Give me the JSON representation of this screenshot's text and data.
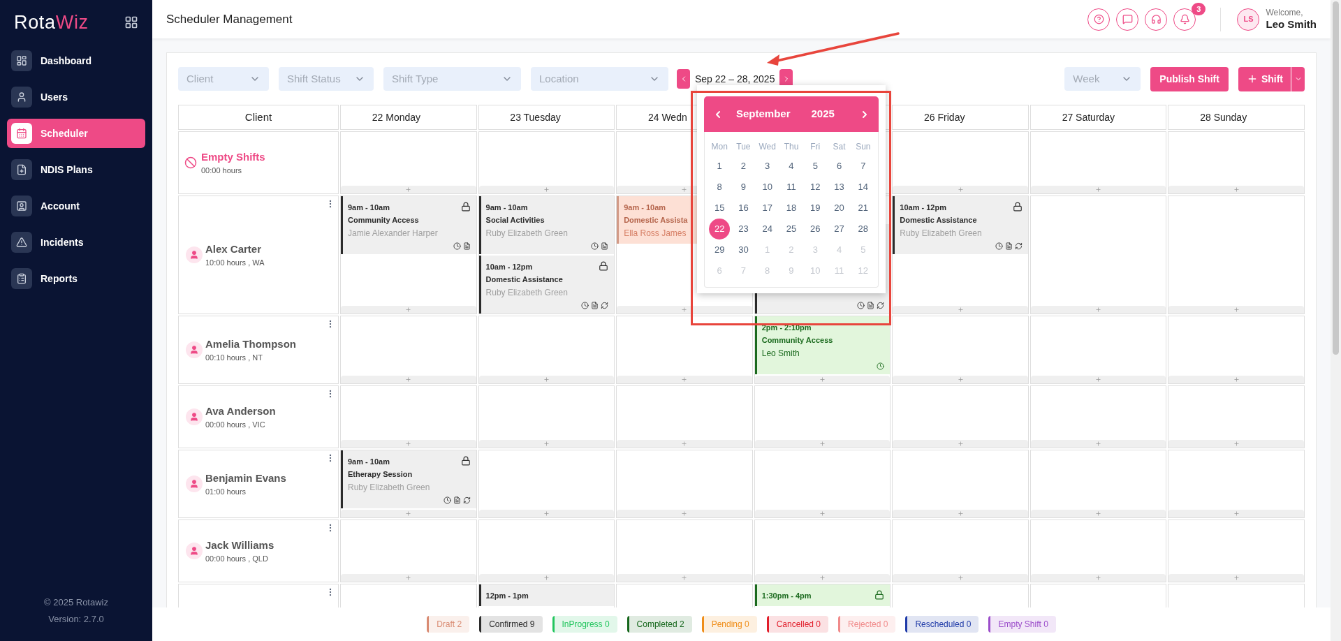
{
  "sidebar": {
    "logo": {
      "first": "Rota",
      "second": "Wiz"
    },
    "items": [
      {
        "label": "Dashboard",
        "selected": false
      },
      {
        "label": "Users",
        "selected": false
      },
      {
        "label": "Scheduler",
        "selected": true
      },
      {
        "label": "NDIS Plans",
        "selected": false
      },
      {
        "label": "Account",
        "selected": false
      },
      {
        "label": "Incidents",
        "selected": false
      },
      {
        "label": "Reports",
        "selected": false
      }
    ],
    "footer": [
      "© 2025 Rotawiz",
      "Version: 2.7.0"
    ]
  },
  "header": {
    "title": "Scheduler Management",
    "notification_count": "3",
    "user": {
      "initials": "LS",
      "greeting": "Welcome,",
      "name": "Leo Smith"
    }
  },
  "toolbar": {
    "filters": [
      {
        "placeholder": "Client"
      },
      {
        "placeholder": "Shift Status"
      },
      {
        "placeholder": "Shift Type"
      },
      {
        "placeholder": "Location"
      }
    ],
    "date_range": "Sep 22 – 28, 2025",
    "view": {
      "placeholder": "Week"
    },
    "publish_button": "Publish Shift",
    "add_button": "Shift"
  },
  "calendar_popup": {
    "month": "September",
    "year": "2025",
    "weekdays": [
      "Mon",
      "Tue",
      "Wed",
      "Thu",
      "Fri",
      "Sat",
      "Sun"
    ],
    "weeks": [
      [
        {
          "d": "1",
          "muted": false,
          "selected": false
        },
        {
          "d": "2",
          "muted": false,
          "selected": false
        },
        {
          "d": "3",
          "muted": false,
          "selected": false
        },
        {
          "d": "4",
          "muted": false,
          "selected": false
        },
        {
          "d": "5",
          "muted": false,
          "selected": false
        },
        {
          "d": "6",
          "muted": false,
          "selected": false
        },
        {
          "d": "7",
          "muted": false,
          "selected": false
        }
      ],
      [
        {
          "d": "8",
          "muted": false,
          "selected": false
        },
        {
          "d": "9",
          "muted": false,
          "selected": false
        },
        {
          "d": "10",
          "muted": false,
          "selected": false
        },
        {
          "d": "11",
          "muted": false,
          "selected": false
        },
        {
          "d": "12",
          "muted": false,
          "selected": false
        },
        {
          "d": "13",
          "muted": false,
          "selected": false
        },
        {
          "d": "14",
          "muted": false,
          "selected": false
        }
      ],
      [
        {
          "d": "15",
          "muted": false,
          "selected": false
        },
        {
          "d": "16",
          "muted": false,
          "selected": false
        },
        {
          "d": "17",
          "muted": false,
          "selected": false
        },
        {
          "d": "18",
          "muted": false,
          "selected": false
        },
        {
          "d": "19",
          "muted": false,
          "selected": false
        },
        {
          "d": "20",
          "muted": false,
          "selected": false
        },
        {
          "d": "21",
          "muted": false,
          "selected": false
        }
      ],
      [
        {
          "d": "22",
          "muted": false,
          "selected": true
        },
        {
          "d": "23",
          "muted": false,
          "selected": false
        },
        {
          "d": "24",
          "muted": false,
          "selected": false
        },
        {
          "d": "25",
          "muted": false,
          "selected": false
        },
        {
          "d": "26",
          "muted": false,
          "selected": false
        },
        {
          "d": "27",
          "muted": false,
          "selected": false
        },
        {
          "d": "28",
          "muted": false,
          "selected": false
        }
      ],
      [
        {
          "d": "29",
          "muted": false,
          "selected": false
        },
        {
          "d": "30",
          "muted": false,
          "selected": false
        },
        {
          "d": "1",
          "muted": true,
          "selected": false
        },
        {
          "d": "2",
          "muted": true,
          "selected": false
        },
        {
          "d": "3",
          "muted": true,
          "selected": false
        },
        {
          "d": "4",
          "muted": true,
          "selected": false
        },
        {
          "d": "5",
          "muted": true,
          "selected": false
        }
      ],
      [
        {
          "d": "6",
          "muted": true,
          "selected": false
        },
        {
          "d": "7",
          "muted": true,
          "selected": false
        },
        {
          "d": "8",
          "muted": true,
          "selected": false
        },
        {
          "d": "9",
          "muted": true,
          "selected": false
        },
        {
          "d": "10",
          "muted": true,
          "selected": false
        },
        {
          "d": "11",
          "muted": true,
          "selected": false
        },
        {
          "d": "12",
          "muted": true,
          "selected": false
        }
      ]
    ]
  },
  "schedule": {
    "client_header": "Client",
    "days": [
      {
        "kind": "label",
        "label": "22 Monday"
      },
      {
        "kind": "label",
        "label": "23 Tuesday"
      },
      {
        "kind": "label",
        "label": "24 Wedn"
      },
      {
        "kind": "covered"
      },
      {
        "kind": "label",
        "label": "26 Friday"
      },
      {
        "kind": "label",
        "label": "27 Saturday"
      },
      {
        "kind": "label",
        "label": "28 Sunday"
      }
    ],
    "rows": [
      {
        "kind": "empty",
        "name": "Empty Shifts",
        "hours": "00:00 hours",
        "cells": [
          [],
          [],
          [],
          [],
          [],
          [],
          []
        ]
      },
      {
        "kind": "client",
        "name": "Alex Carter",
        "hours": "10:00 hours , WA",
        "cells": [
          [
            {
              "kind": "confirmed",
              "time": "9am - 10am",
              "type": "Community Access",
              "worker": "Jamie Alexander Harper",
              "locked": true,
              "timesheet": true,
              "notes": true,
              "recurring": false
            }
          ],
          [
            {
              "kind": "confirmed",
              "time": "9am - 10am",
              "type": "Social Activities",
              "worker": "Ruby Elizabeth Green",
              "locked": false,
              "timesheet": true,
              "notes": true,
              "recurring": false
            },
            {
              "kind": "confirmed",
              "time": "10am - 12pm",
              "type": "Domestic Assistance",
              "worker": "Ruby Elizabeth Green",
              "locked": true,
              "timesheet": true,
              "notes": true,
              "recurring": true
            }
          ],
          [
            {
              "kind": "draft",
              "time": "9am - 10am",
              "type": "Domestic Assista",
              "worker": "Ella Ross James"
            }
          ],
          [
            {
              "kind": "confirmed",
              "timesheet": true,
              "notes": true,
              "recurring": true
            }
          ],
          [
            {
              "kind": "confirmed",
              "time": "10am - 12pm",
              "type": "Domestic Assistance",
              "worker": "Ruby Elizabeth Green",
              "locked": true,
              "timesheet": true,
              "notes": true,
              "recurring": true
            }
          ],
          [],
          []
        ]
      },
      {
        "kind": "client",
        "name": "Amelia Thompson",
        "hours": "00:10 hours , NT",
        "cells": [
          [],
          [],
          [],
          [
            {
              "kind": "completed",
              "time": "2pm - 2:10pm",
              "type": "Community Access",
              "worker": "Leo Smith",
              "locked": false,
              "timesheet": true,
              "notes": false,
              "recurring": false
            }
          ],
          [],
          [],
          []
        ]
      },
      {
        "kind": "client",
        "name": "Ava Anderson",
        "hours": "00:00 hours , VIC",
        "cells": [
          [],
          [],
          [],
          [],
          [],
          [],
          []
        ]
      },
      {
        "kind": "client",
        "name": "Benjamin Evans",
        "hours": "01:00 hours",
        "cells": [
          [
            {
              "kind": "confirmed",
              "time": "9am - 10am",
              "type": "Etherapy Session",
              "worker": "Ruby Elizabeth Green",
              "locked": true,
              "timesheet": true,
              "notes": true,
              "recurring": true
            }
          ],
          [],
          [],
          [],
          [],
          [],
          []
        ]
      },
      {
        "kind": "client",
        "name": "Jack Williams",
        "hours": "00:00 hours , QLD",
        "cells": [
          [],
          [],
          [],
          [],
          [],
          [],
          []
        ]
      },
      {
        "kind": "client",
        "cells": [
          [],
          [
            {
              "kind": "confirmed",
              "time": "12pm - 1pm",
              "locked": false,
              "timesheet": false,
              "notes": false,
              "recurring": false
            }
          ],
          [],
          [
            {
              "kind": "completed",
              "time": "1:30pm - 4pm",
              "locked": true,
              "timesheet": false,
              "notes": false,
              "recurring": false
            }
          ],
          [],
          [],
          []
        ]
      }
    ]
  },
  "legend": [
    {
      "label": "Draft 2",
      "color": "#d98b72"
    },
    {
      "label": "Confirmed 9",
      "color": "#2b2b2b"
    },
    {
      "label": "InProgress 0",
      "color": "#22c55e"
    },
    {
      "label": "Completed 2",
      "color": "#15661b"
    },
    {
      "label": "Pending 0",
      "color": "#ef8e1a"
    },
    {
      "label": "Cancelled 0",
      "color": "#e11d2a"
    },
    {
      "label": "Rejected 0",
      "color": "#f08a8a"
    },
    {
      "label": "Rescheduled 0",
      "color": "#1e3aa8"
    },
    {
      "label": "Empty Shift 0",
      "color": "#9b4dca"
    }
  ]
}
